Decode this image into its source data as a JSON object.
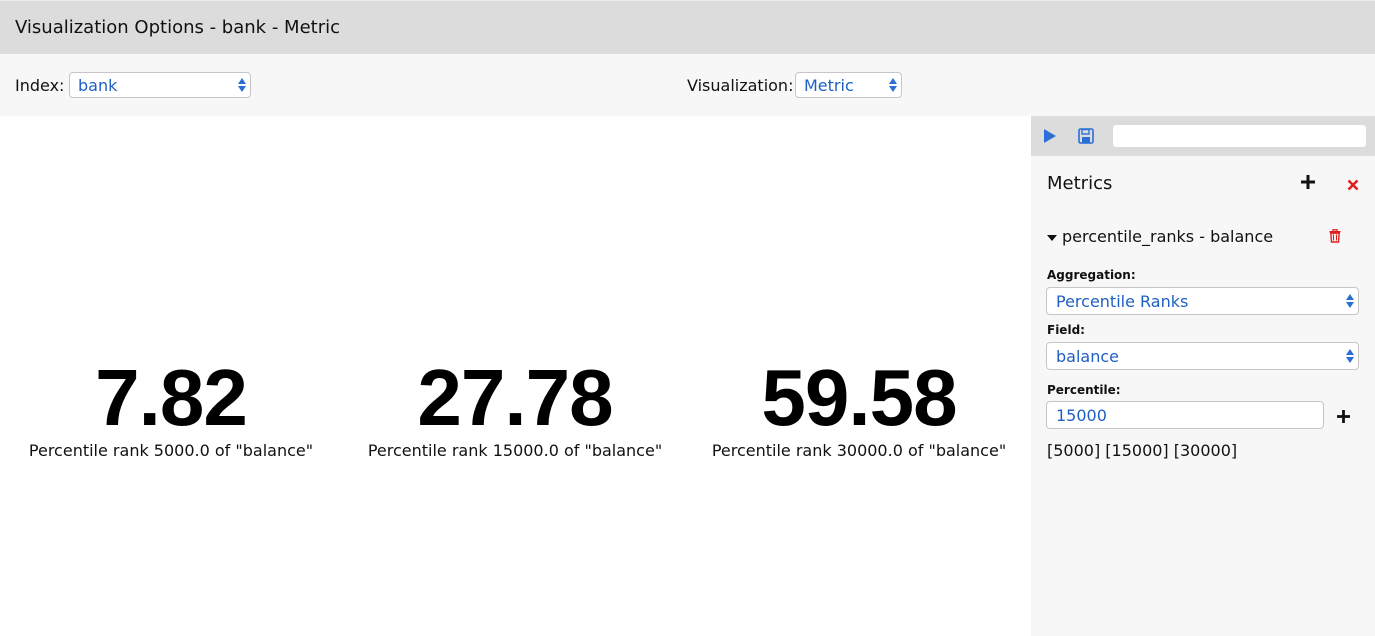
{
  "window": {
    "title": "Visualization Options - bank - Metric"
  },
  "options": {
    "index_label": "Index:",
    "index_value": "bank",
    "visualization_label": "Visualization:",
    "visualization_value": "Metric"
  },
  "metrics_display": [
    {
      "value": "7.82",
      "label": "Percentile rank 5000.0 of \"balance\""
    },
    {
      "value": "27.78",
      "label": "Percentile rank 15000.0 of \"balance\""
    },
    {
      "value": "59.58",
      "label": "Percentile rank 30000.0 of \"balance\""
    }
  ],
  "panel": {
    "toolbar": {
      "run_icon": "play-icon",
      "save_icon": "save-icon",
      "search_value": ""
    },
    "heading": "Metrics",
    "add_icon": "plus-icon",
    "close_icon": "close-icon",
    "aggregation_item": {
      "title": "percentile_ranks - balance",
      "delete_icon": "trash-icon"
    },
    "aggregation_label": "Aggregation:",
    "aggregation_value": "Percentile Ranks",
    "field_label": "Field:",
    "field_value": "balance",
    "percentile_label": "Percentile:",
    "percentile_value": "15000",
    "percentiles_list": "[5000] [15000] [30000]"
  },
  "colors": {
    "accent_blue": "#1f5fc4",
    "delete_red": "#e02020",
    "titlebar_gray": "#dcdcdc"
  }
}
